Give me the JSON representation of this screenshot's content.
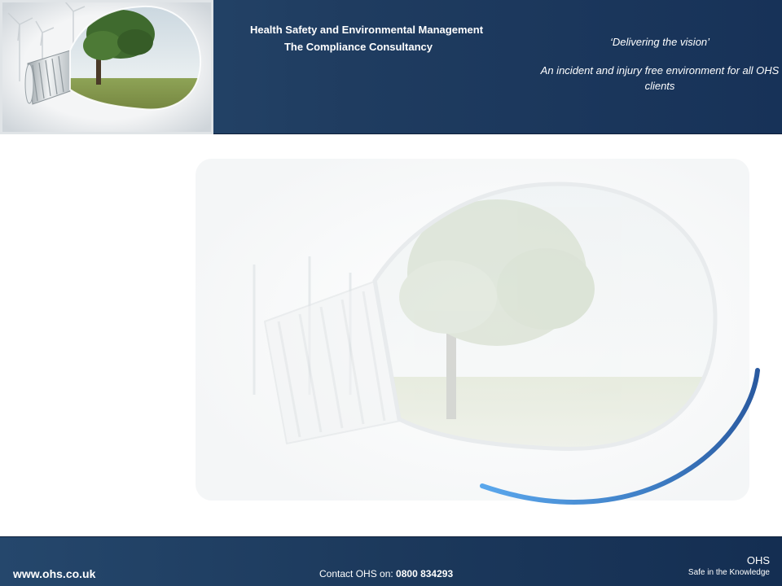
{
  "header": {
    "title_line1": "Health Safety and Environmental Management",
    "title_line2": "The Compliance Consultancy",
    "tagline_quote": "‘Delivering the vision’",
    "vision_statement": "An incident and injury free environment for all OHS clients"
  },
  "footer": {
    "website": "www.ohs.co.uk",
    "contact_label": "Contact OHS on: ",
    "contact_number": "0800 834293",
    "brand_name": "OHS",
    "brand_slogan": "Safe in the Knowledge"
  },
  "colors": {
    "header_bg": "#1f3c60",
    "footer_bg": "#1c395c",
    "arc_accent": "#4a8fd8",
    "text": "#ffffff"
  },
  "icons": {
    "header_image": "lightbulb-tree-photo",
    "watermark": "lightbulb-tree-watermark"
  }
}
